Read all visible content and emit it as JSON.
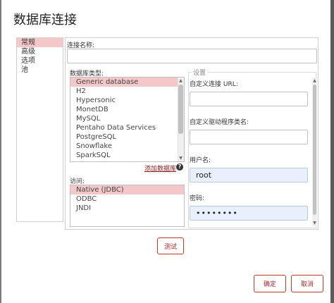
{
  "dialog": {
    "title": "数据库连接",
    "nav": [
      {
        "label": "常规",
        "active": true
      },
      {
        "label": "高级",
        "active": false
      },
      {
        "label": "选项",
        "active": false
      },
      {
        "label": "池",
        "active": false
      }
    ],
    "connection_name": {
      "label": "连接名称:",
      "value": ""
    },
    "db_type": {
      "label": "数据库类型:",
      "items": [
        "Generic database",
        "H2",
        "Hypersonic",
        "MonetDB",
        "MySQL",
        "Pentaho Data Services",
        "PostgreSQL",
        "Snowflake",
        "SparkSQL"
      ],
      "selected": "Generic database"
    },
    "add_driver_link": "添加数据库",
    "access": {
      "label": "访问:",
      "items": [
        "Native (JDBC)",
        "ODBC",
        "JNDI"
      ],
      "selected": "Native (JDBC)"
    },
    "settings": {
      "legend": "设置",
      "custom_url": {
        "label": "自定义连接 URL:",
        "value": ""
      },
      "custom_driver": {
        "label": "自定义驱动程序类名:",
        "value": ""
      },
      "username": {
        "label": "用户名:",
        "value": "root"
      },
      "password": {
        "label": "密码:",
        "value": "••••••••"
      }
    },
    "buttons": {
      "test": "测试",
      "ok": "确定",
      "cancel": "取消"
    },
    "colors": {
      "accent": "#c0392b",
      "selection": "#f4c7c9",
      "autofill": "#e8f0fe"
    }
  }
}
